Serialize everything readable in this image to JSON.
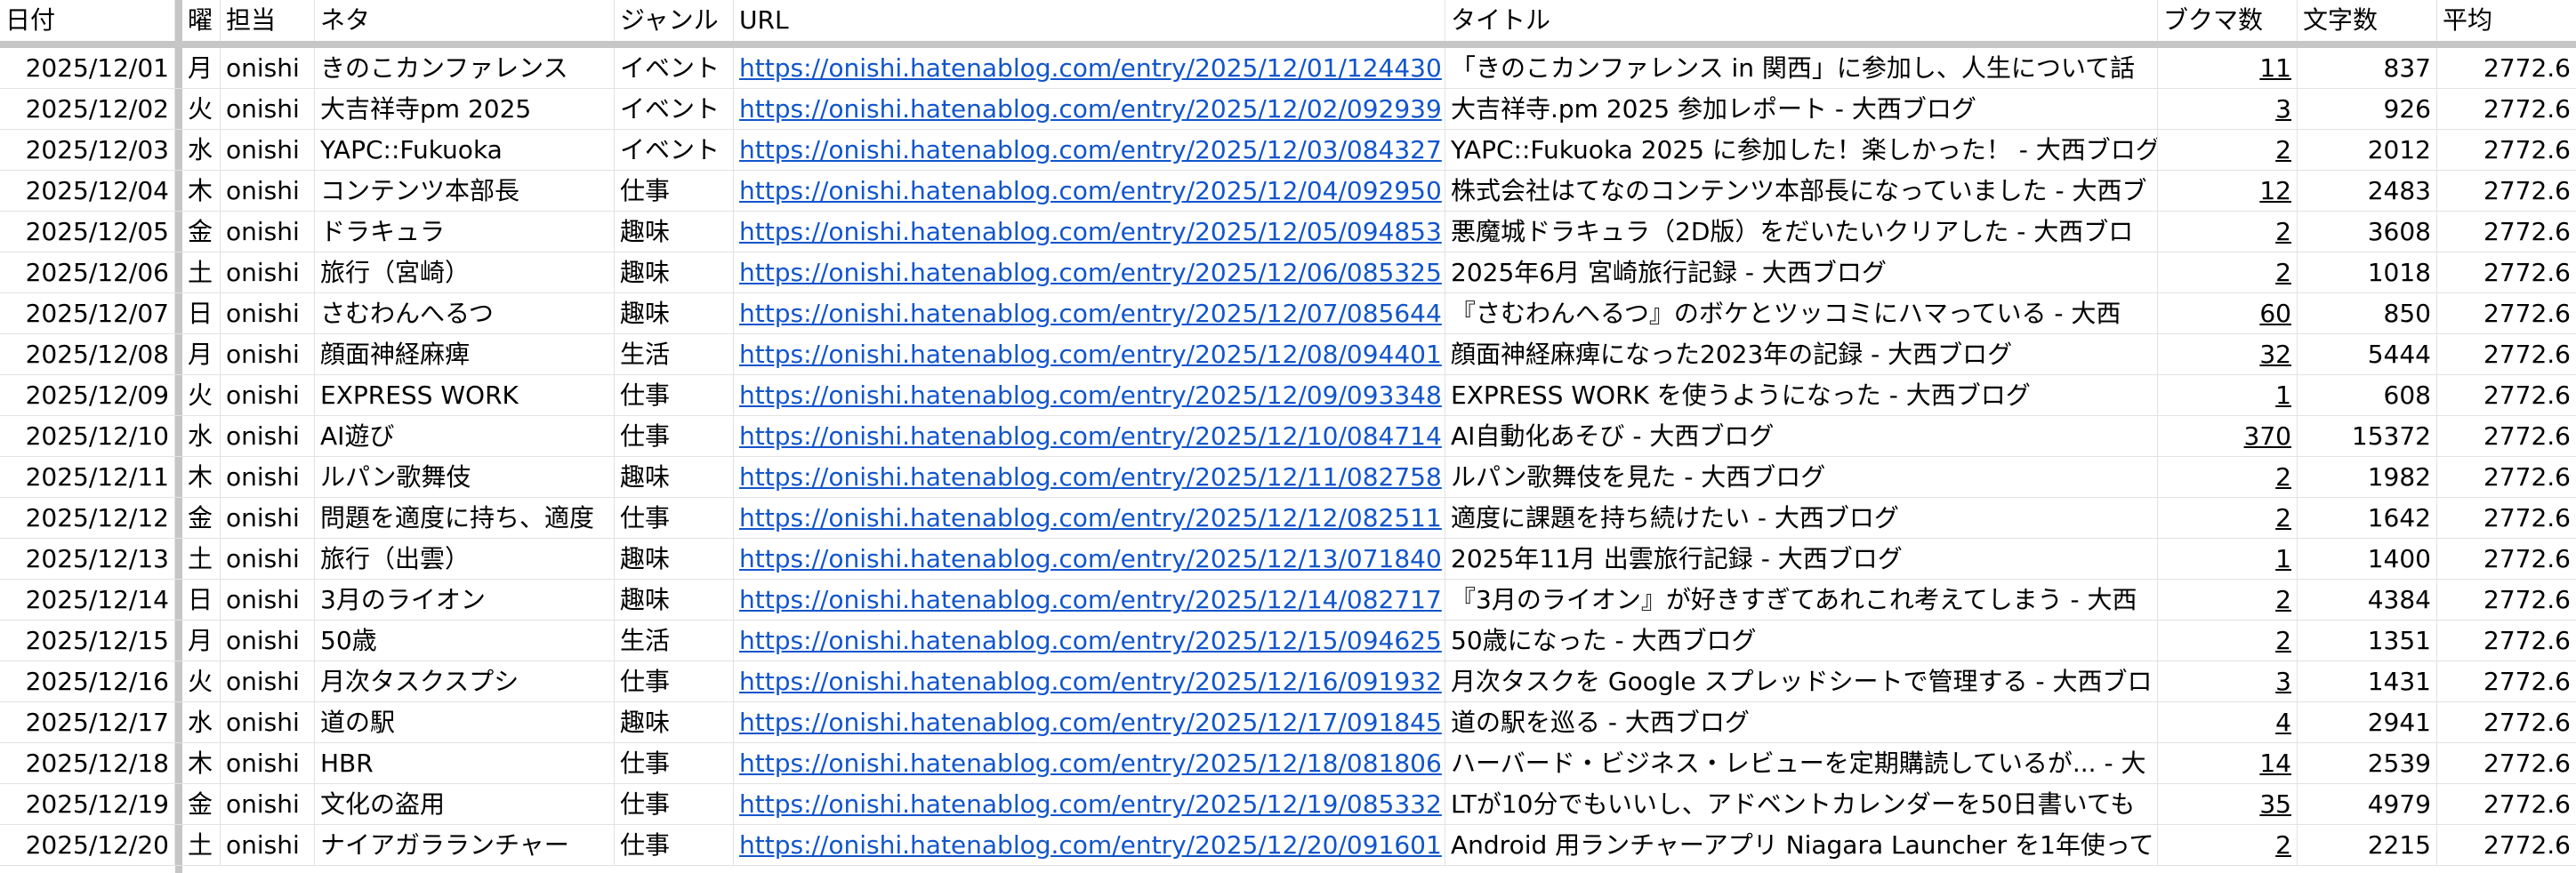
{
  "headers": {
    "date": "日付",
    "day": "曜",
    "owner": "担当",
    "topic": "ネタ",
    "genre": "ジャンル",
    "url": "URL",
    "title": "タイトル",
    "bookmarks": "ブクマ数",
    "chars": "文字数",
    "avg": "平均"
  },
  "rows": [
    {
      "date": "2025/12/01",
      "day": "月",
      "owner": "onishi",
      "topic": "きのこカンファレンス",
      "genre": "イベント",
      "url": "https://onishi.hatenablog.com/entry/2025/12/01/124430",
      "title": "「きのこカンファレンス in 関西」に参加し、人生について話",
      "bookmarks": "11",
      "chars": "837",
      "avg": "2772.6"
    },
    {
      "date": "2025/12/02",
      "day": "火",
      "owner": "onishi",
      "topic": "大吉祥寺pm 2025",
      "genre": "イベント",
      "url": "https://onishi.hatenablog.com/entry/2025/12/02/092939",
      "title": "大吉祥寺.pm 2025 参加レポート - 大西ブログ",
      "bookmarks": "3",
      "chars": "926",
      "avg": "2772.6"
    },
    {
      "date": "2025/12/03",
      "day": "水",
      "owner": "onishi",
      "topic": "YAPC::Fukuoka",
      "genre": "イベント",
      "url": "https://onishi.hatenablog.com/entry/2025/12/03/084327",
      "title": "YAPC::Fukuoka 2025 に参加した！楽しかった！ - 大西ブログ",
      "bookmarks": "2",
      "chars": "2012",
      "avg": "2772.6"
    },
    {
      "date": "2025/12/04",
      "day": "木",
      "owner": "onishi",
      "topic": "コンテンツ本部長",
      "genre": "仕事",
      "url": "https://onishi.hatenablog.com/entry/2025/12/04/092950",
      "title": "株式会社はてなのコンテンツ本部長になっていました - 大西ブ",
      "bookmarks": "12",
      "chars": "2483",
      "avg": "2772.6"
    },
    {
      "date": "2025/12/05",
      "day": "金",
      "owner": "onishi",
      "topic": "ドラキュラ",
      "genre": "趣味",
      "url": "https://onishi.hatenablog.com/entry/2025/12/05/094853",
      "title": "悪魔城ドラキュラ（2D版）をだいたいクリアした - 大西ブロ",
      "bookmarks": "2",
      "chars": "3608",
      "avg": "2772.6"
    },
    {
      "date": "2025/12/06",
      "day": "土",
      "owner": "onishi",
      "topic": "旅行（宮崎）",
      "genre": "趣味",
      "url": "https://onishi.hatenablog.com/entry/2025/12/06/085325",
      "title": "2025年6月 宮崎旅行記録 - 大西ブログ",
      "bookmarks": "2",
      "chars": "1018",
      "avg": "2772.6"
    },
    {
      "date": "2025/12/07",
      "day": "日",
      "owner": "onishi",
      "topic": "さむわんへるつ",
      "genre": "趣味",
      "url": "https://onishi.hatenablog.com/entry/2025/12/07/085644",
      "title": "『さむわんへるつ』のボケとツッコミにハマっている - 大西",
      "bookmarks": "60",
      "chars": "850",
      "avg": "2772.6"
    },
    {
      "date": "2025/12/08",
      "day": "月",
      "owner": "onishi",
      "topic": "顔面神経麻痺",
      "genre": "生活",
      "url": "https://onishi.hatenablog.com/entry/2025/12/08/094401",
      "title": "顔面神経麻痺になった2023年の記録 - 大西ブログ",
      "bookmarks": "32",
      "chars": "5444",
      "avg": "2772.6"
    },
    {
      "date": "2025/12/09",
      "day": "火",
      "owner": "onishi",
      "topic": "EXPRESS WORK",
      "genre": "仕事",
      "url": "https://onishi.hatenablog.com/entry/2025/12/09/093348",
      "title": "EXPRESS WORK を使うようになった - 大西ブログ",
      "bookmarks": "1",
      "chars": "608",
      "avg": "2772.6"
    },
    {
      "date": "2025/12/10",
      "day": "水",
      "owner": "onishi",
      "topic": "AI遊び",
      "genre": "仕事",
      "url": "https://onishi.hatenablog.com/entry/2025/12/10/084714",
      "title": "AI自動化あそび - 大西ブログ",
      "bookmarks": "370",
      "chars": "15372",
      "avg": "2772.6"
    },
    {
      "date": "2025/12/11",
      "day": "木",
      "owner": "onishi",
      "topic": "ルパン歌舞伎",
      "genre": "趣味",
      "url": "https://onishi.hatenablog.com/entry/2025/12/11/082758",
      "title": "ルパン歌舞伎を見た - 大西ブログ",
      "bookmarks": "2",
      "chars": "1982",
      "avg": "2772.6"
    },
    {
      "date": "2025/12/12",
      "day": "金",
      "owner": "onishi",
      "topic": "問題を適度に持ち、適度",
      "genre": "仕事",
      "url": "https://onishi.hatenablog.com/entry/2025/12/12/082511",
      "title": "適度に課題を持ち続けたい - 大西ブログ",
      "bookmarks": "2",
      "chars": "1642",
      "avg": "2772.6"
    },
    {
      "date": "2025/12/13",
      "day": "土",
      "owner": "onishi",
      "topic": "旅行（出雲）",
      "genre": "趣味",
      "url": "https://onishi.hatenablog.com/entry/2025/12/13/071840",
      "title": "2025年11月 出雲旅行記録 - 大西ブログ",
      "bookmarks": "1",
      "chars": "1400",
      "avg": "2772.6"
    },
    {
      "date": "2025/12/14",
      "day": "日",
      "owner": "onishi",
      "topic": "3月のライオン",
      "genre": "趣味",
      "url": "https://onishi.hatenablog.com/entry/2025/12/14/082717",
      "title": "『3月のライオン』が好きすぎてあれこれ考えてしまう - 大西",
      "bookmarks": "2",
      "chars": "4384",
      "avg": "2772.6"
    },
    {
      "date": "2025/12/15",
      "day": "月",
      "owner": "onishi",
      "topic": "50歳",
      "genre": "生活",
      "url": "https://onishi.hatenablog.com/entry/2025/12/15/094625",
      "title": "50歳になった - 大西ブログ",
      "bookmarks": "2",
      "chars": "1351",
      "avg": "2772.6"
    },
    {
      "date": "2025/12/16",
      "day": "火",
      "owner": "onishi",
      "topic": "月次タスクスプシ",
      "genre": "仕事",
      "url": "https://onishi.hatenablog.com/entry/2025/12/16/091932",
      "title": "月次タスクを Google スプレッドシートで管理する - 大西ブロ",
      "bookmarks": "3",
      "chars": "1431",
      "avg": "2772.6"
    },
    {
      "date": "2025/12/17",
      "day": "水",
      "owner": "onishi",
      "topic": "道の駅",
      "genre": "趣味",
      "url": "https://onishi.hatenablog.com/entry/2025/12/17/091845",
      "title": "道の駅を巡る - 大西ブログ",
      "bookmarks": "4",
      "chars": "2941",
      "avg": "2772.6"
    },
    {
      "date": "2025/12/18",
      "day": "木",
      "owner": "onishi",
      "topic": "HBR",
      "genre": "仕事",
      "url": "https://onishi.hatenablog.com/entry/2025/12/18/081806",
      "title": "ハーバード・ビジネス・レビューを定期購読しているが... - 大",
      "bookmarks": "14",
      "chars": "2539",
      "avg": "2772.6"
    },
    {
      "date": "2025/12/19",
      "day": "金",
      "owner": "onishi",
      "topic": "文化の盗用",
      "genre": "仕事",
      "url": "https://onishi.hatenablog.com/entry/2025/12/19/085332",
      "title": "LTが10分でもいいし、アドベントカレンダーを50日書いても",
      "bookmarks": "35",
      "chars": "4979",
      "avg": "2772.6"
    },
    {
      "date": "2025/12/20",
      "day": "土",
      "owner": "onishi",
      "topic": "ナイアガラランチャー",
      "genre": "仕事",
      "url": "https://onishi.hatenablog.com/entry/2025/12/20/091601",
      "title": "Android 用ランチャーアプリ Niagara Launcher を1年使ってい",
      "bookmarks": "2",
      "chars": "2215",
      "avg": "2772.6"
    }
  ]
}
